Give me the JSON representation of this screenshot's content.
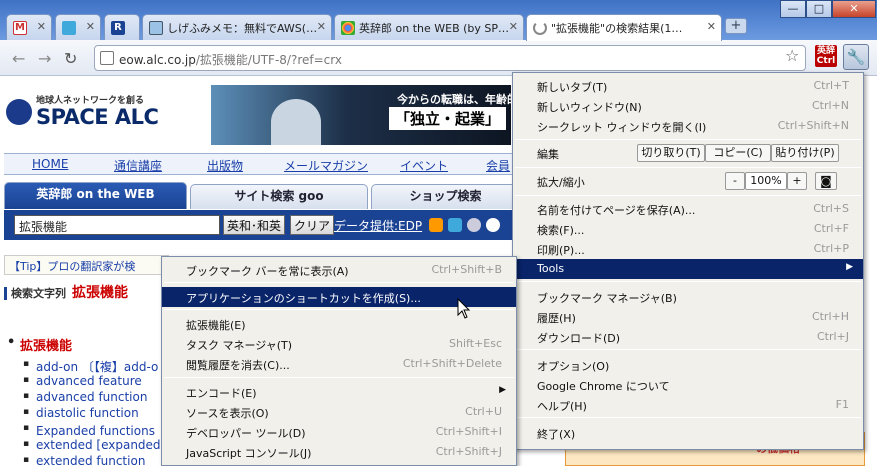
{
  "tabs": [
    {
      "label": "M",
      "icon": "gmail-icon"
    },
    {
      "label": "",
      "icon": "twitter-icon"
    },
    {
      "label": "R",
      "icon": "reader-icon"
    },
    {
      "label": "しげふみメモ：無料でAWS(…",
      "icon": "page-icon"
    },
    {
      "label": "英辞郎 on the WEB (by SP…",
      "icon": "chrome-icon"
    },
    {
      "label": "\"拡張機能\"の検索結果(1…",
      "icon": "loading-icon"
    }
  ],
  "toolbar": {
    "url_host": "eow.alc.co.jp",
    "url_path": "/拡張機能/UTF-8/?ref=crx",
    "ext_label": "英辞\nCtrl"
  },
  "site": {
    "logo_tag": "地球人ネットワークを創る",
    "logo_main": "SPACE ALC",
    "banner_line1": "今からの転職は、年齢的",
    "banner_line2": "「独立・起業」",
    "nav": [
      "HOME",
      "通信講座",
      "出版物",
      "メールマガジン",
      "イベント",
      "会員"
    ],
    "search_tabs": [
      "英辞郎 on the WEB",
      "サイト検索 goo",
      "ショップ検索"
    ],
    "query": "拡張機能",
    "btn_dict": "英和･和英",
    "btn_clear": "クリア",
    "provide": "データ提供:EDP",
    "tip": "【Tip】プロの翻訳家が検",
    "sword_label": "検索文字列",
    "sword_value": "拡張機能",
    "result_head": "拡張機能",
    "results": [
      "add-on 〔【複】add-o",
      "advanced feature",
      "advanced function",
      "diastolic function",
      "Expanded functions 〈",
      "extended [expanded]",
      "extended function"
    ],
    "ad_text": "の低価格"
  },
  "wrench_menu": {
    "items": [
      {
        "label": "新しいタブ(T)",
        "shortcut": "Ctrl+T"
      },
      {
        "label": "新しいウィンドウ(N)",
        "shortcut": "Ctrl+N"
      },
      {
        "label": "シークレット ウィンドウを開く(I)",
        "shortcut": "Ctrl+Shift+N"
      },
      {
        "label": "編集"
      },
      {
        "label": "拡大/縮小"
      },
      {
        "label": "名前を付けてページを保存(A)...",
        "shortcut": "Ctrl+S"
      },
      {
        "label": "検索(F)...",
        "shortcut": "Ctrl+F"
      },
      {
        "label": "印刷(P)...",
        "shortcut": "Ctrl+P"
      },
      {
        "label": "Tools"
      },
      {
        "label": "ブックマーク マネージャ(B)"
      },
      {
        "label": "履歴(H)",
        "shortcut": "Ctrl+H"
      },
      {
        "label": "ダウンロード(D)",
        "shortcut": "Ctrl+J"
      },
      {
        "label": "オプション(O)"
      },
      {
        "label": "Google Chrome について"
      },
      {
        "label": "ヘルプ(H)",
        "shortcut": "F1"
      },
      {
        "label": "終了(X)"
      }
    ],
    "edit_buttons": [
      "切り取り(T)",
      "コピー(C)",
      "貼り付け(P)"
    ],
    "zoom_minus": "-",
    "zoom_value": "100%",
    "zoom_plus": "+"
  },
  "tools_menu": {
    "items": [
      {
        "label": "ブックマーク バーを常に表示(A)",
        "shortcut": "Ctrl+Shift+B"
      },
      {
        "label": "アプリケーションのショートカットを作成(S)..."
      },
      {
        "label": "拡張機能(E)"
      },
      {
        "label": "タスク マネージャ(T)",
        "shortcut": "Shift+Esc"
      },
      {
        "label": "閲覧履歴を消去(C)...",
        "shortcut": "Ctrl+Shift+Delete"
      },
      {
        "label": "エンコード(E)"
      },
      {
        "label": "ソースを表示(O)",
        "shortcut": "Ctrl+U"
      },
      {
        "label": "デベロッパー ツール(D)",
        "shortcut": "Ctrl+Shift+I"
      },
      {
        "label": "JavaScript コンソール(J)",
        "shortcut": "Ctrl+Shift+J"
      }
    ]
  }
}
